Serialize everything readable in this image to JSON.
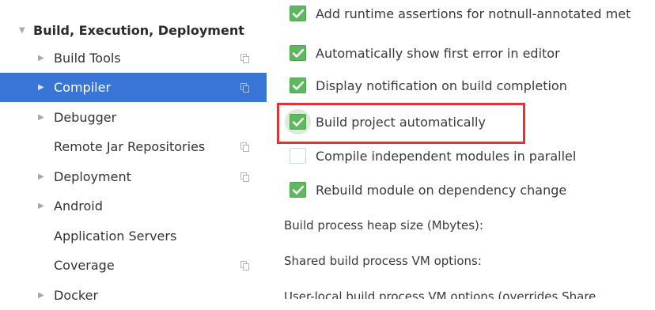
{
  "sidebar": {
    "section": {
      "label": "Build, Execution, Deployment",
      "expanded": true
    },
    "items": [
      {
        "label": "Build Tools",
        "has_arrow": true,
        "has_copy_icon": true,
        "selected": false
      },
      {
        "label": "Compiler",
        "has_arrow": true,
        "has_copy_icon": true,
        "selected": true
      },
      {
        "label": "Debugger",
        "has_arrow": true,
        "has_copy_icon": false,
        "selected": false
      },
      {
        "label": "Remote Jar Repositories",
        "has_arrow": false,
        "has_copy_icon": true,
        "selected": false
      },
      {
        "label": "Deployment",
        "has_arrow": true,
        "has_copy_icon": true,
        "selected": false
      },
      {
        "label": "Android",
        "has_arrow": true,
        "has_copy_icon": false,
        "selected": false
      },
      {
        "label": "Application Servers",
        "has_arrow": false,
        "has_copy_icon": false,
        "selected": false
      },
      {
        "label": "Coverage",
        "has_arrow": false,
        "has_copy_icon": true,
        "selected": false
      },
      {
        "label": "Docker",
        "has_arrow": true,
        "has_copy_icon": false,
        "selected": false
      }
    ]
  },
  "compiler_options": {
    "checkboxes": [
      {
        "label": "Add runtime assertions for notnull-annotated met",
        "checked": true
      },
      {
        "label": "Automatically show first error in editor",
        "checked": true
      },
      {
        "label": "Display notification on build completion",
        "checked": true
      },
      {
        "label": "Build project automatically",
        "checked": true,
        "highlighted": true
      },
      {
        "label": "Compile independent modules in parallel",
        "checked": false
      },
      {
        "label": "Rebuild module on dependency change",
        "checked": true
      }
    ],
    "fields": [
      {
        "label": "Build process heap size (Mbytes):"
      },
      {
        "label": "Shared build process VM options:"
      },
      {
        "label": "User-local build process VM options (overrides Share"
      }
    ]
  },
  "colors": {
    "selection": "#3875d7",
    "checkbox_checked": "#5fb85f",
    "highlight_border": "#e0333a"
  },
  "icons": {
    "expanded_arrow": "triangle-down-icon",
    "collapsed_arrow": "triangle-right-icon",
    "copy": "copy-settings-icon",
    "check": "checkmark-icon"
  }
}
